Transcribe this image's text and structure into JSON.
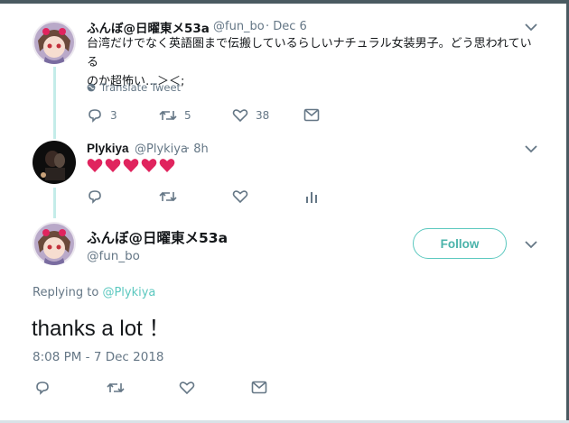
{
  "tweet1": {
    "name": "ふんぼ@日曜東メ53a",
    "handle": "@fun_bo",
    "time": "· Dec 6",
    "text_line1": "台湾だけでなく英語圏まで伝搬しているらしいナチュラル女装男子。どう思われている",
    "text_line2": "のか超怖い…＞＜;",
    "translate_label": "Translate Tweet",
    "reply_count": "3",
    "retweet_count": "5",
    "like_count": "38"
  },
  "tweet2": {
    "name": "Plykiya",
    "handle": "@Plykiya",
    "time": "· 8h",
    "hearts": [
      "❤",
      "❤",
      "❤",
      "❤",
      "❤"
    ]
  },
  "main_tweet": {
    "name": "ふんぼ@日曜東メ53a",
    "handle": "@fun_bo",
    "follow_label": "Follow",
    "replying_prefix": "Replying to ",
    "replying_handle": "@Plykiya",
    "text": "thanks a lot ！",
    "timestamp": "8:08 PM - 7 Dec 2018"
  },
  "colors": {
    "accent": "#5bc8bf",
    "heart_red": "#e0245e",
    "muted": "#657786",
    "thread_line": "#c4ece9"
  },
  "icons": [
    "reply-icon",
    "retweet-icon",
    "like-icon",
    "dm-icon",
    "analytics-icon",
    "chevron-down-icon",
    "globe-icon"
  ]
}
